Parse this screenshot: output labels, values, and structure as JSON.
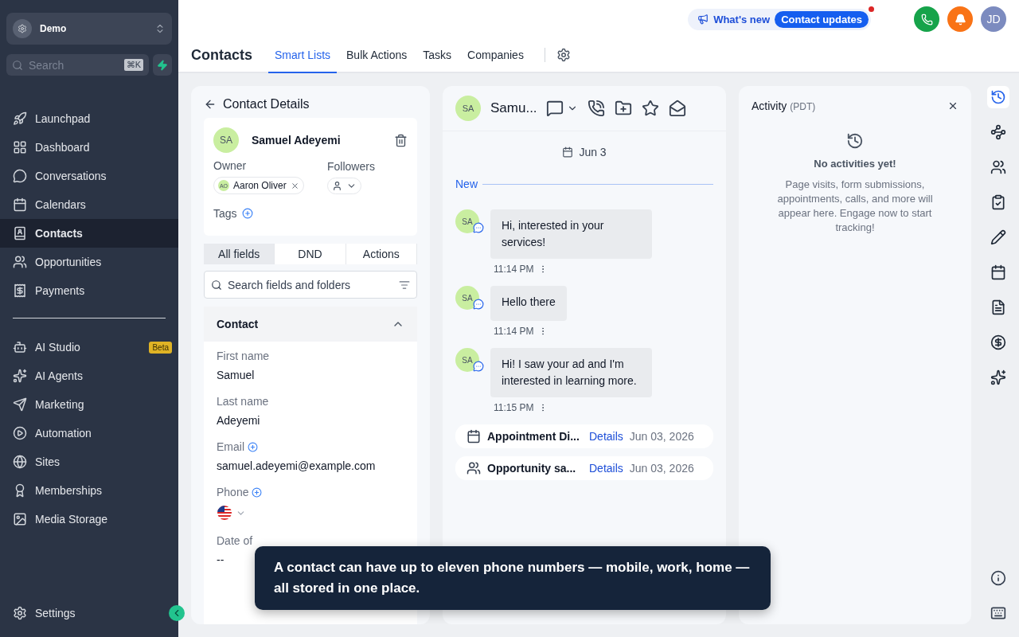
{
  "sidebar": {
    "account": {
      "name": "Demo"
    },
    "search": {
      "placeholder": "Search",
      "shortcut": "⌘K"
    },
    "items": [
      {
        "label": "Launchpad",
        "selected": false
      },
      {
        "label": "Dashboard",
        "selected": false
      },
      {
        "label": "Conversations",
        "selected": false
      },
      {
        "label": "Calendars",
        "selected": false
      },
      {
        "label": "Contacts",
        "selected": true
      },
      {
        "label": "Opportunities",
        "selected": false
      },
      {
        "label": "Payments",
        "selected": false
      }
    ],
    "items_2": [
      {
        "label": "AI Studio",
        "selected": false,
        "badge": "Beta"
      },
      {
        "label": "AI Agents",
        "selected": false
      },
      {
        "label": "Marketing",
        "selected": false
      },
      {
        "label": "Automation",
        "selected": false
      },
      {
        "label": "Sites",
        "selected": false
      },
      {
        "label": "Memberships",
        "selected": false
      },
      {
        "label": "Media Storage",
        "selected": false
      }
    ],
    "settings": {
      "label": "Settings"
    }
  },
  "header": {
    "whats_new": {
      "label": "What's new",
      "button": "Contact updates",
      "unread": true
    },
    "avatar": "JD",
    "title": "Contacts",
    "tabs": [
      {
        "label": "Smart Lists",
        "selected": true
      },
      {
        "label": "Bulk Actions",
        "selected": false
      },
      {
        "label": "Tasks",
        "selected": false
      },
      {
        "label": "Companies",
        "selected": false
      }
    ]
  },
  "contact_details": {
    "title": "Contact Details",
    "initials": "SA",
    "name": "Samuel Adeyemi",
    "owner": {
      "label": "Owner",
      "initials": "AO",
      "name": "Aaron Oliver"
    },
    "followers": {
      "label": "Followers"
    },
    "tags": {
      "label": "Tags"
    },
    "tabs": [
      {
        "label": "All fields",
        "selected": true
      },
      {
        "label": "DND",
        "selected": false
      },
      {
        "label": "Actions",
        "selected": false
      }
    ],
    "search": {
      "placeholder": "Search fields and folders"
    },
    "section": {
      "title": "Contact",
      "expanded": true
    },
    "fields": [
      {
        "label": "First name",
        "value": "Samuel",
        "addable": false
      },
      {
        "label": "Last name",
        "value": "Adeyemi",
        "addable": false
      },
      {
        "label": "Email",
        "value": "samuel.adeyemi@example.com",
        "addable": true
      },
      {
        "label": "Phone",
        "kind": "phone",
        "addable": true
      },
      {
        "label": "Date of",
        "value": "--",
        "addable": false
      }
    ]
  },
  "conversation": {
    "initials": "SA",
    "name": "Samu...",
    "date": "Jun 3",
    "divider": "New",
    "messages": [
      {
        "initials": "SA",
        "text": "Hi, interested in your services!",
        "time": "11:14 PM"
      },
      {
        "initials": "SA",
        "text": "Hello there",
        "time": "11:14 PM"
      },
      {
        "initials": "SA",
        "text": "Hi! I saw your ad and I'm interested in learning more.",
        "time": "11:15 PM"
      }
    ],
    "events": [
      {
        "kind": "appointment",
        "title": "Appointment Di...",
        "link": "Details",
        "date": "Jun 03, 2026"
      },
      {
        "kind": "opportunity",
        "title": "Opportunity sa...",
        "link": "Details",
        "date": "Jun 03, 2026"
      }
    ]
  },
  "activity": {
    "title": "Activity",
    "timezone": "(PDT)",
    "empty_title": "No activities yet!",
    "empty_text": "Page visits, form submissions, appointments, calls, and more will appear here. Engage now to start tracking!"
  },
  "tooltip": {
    "text": "A contact can have up to eleven phone numbers — mobile, work, home — all stored in one place."
  }
}
